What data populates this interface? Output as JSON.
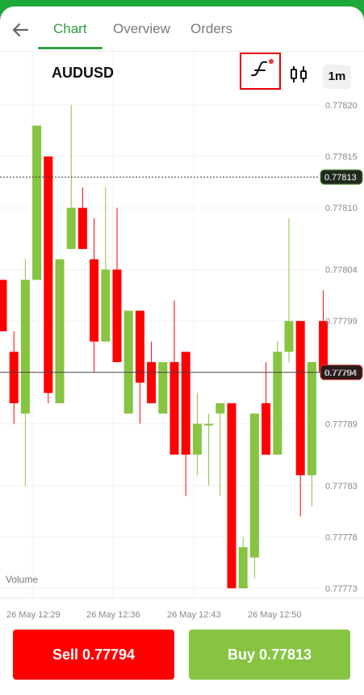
{
  "tabs": [
    {
      "label": "Chart",
      "active": true
    },
    {
      "label": "Overview",
      "active": false
    },
    {
      "label": "Orders",
      "active": false
    }
  ],
  "symbol": "AUDUSD",
  "timeframe": "1m",
  "toolbar": {
    "indicator_icon": "indicator-f-icon",
    "candle_icon": "candlestick-icon"
  },
  "chart_data": {
    "type": "candlestick",
    "y_ticks": [
      "0.77820",
      "0.77815",
      "0.77810",
      "0.77804",
      "0.77799",
      "0.77794",
      "0.77789",
      "0.77783",
      "0.77778",
      "0.77773"
    ],
    "ask_price": "0.77813",
    "bid_price": "0.77794",
    "x_ticks": [
      "26 May 12:29",
      "26 May 12:36",
      "26 May 12:43",
      "26 May 12:50"
    ],
    "volume_label": "Volume",
    "colors": {
      "up": "#86c442",
      "down": "#ff0000"
    },
    "candles": [
      {
        "o": 0.77803,
        "h": 0.77803,
        "l": 0.77798,
        "c": 0.77798
      },
      {
        "o": 0.77796,
        "h": 0.77798,
        "l": 0.77789,
        "c": 0.77791
      },
      {
        "o": 0.7779,
        "h": 0.77805,
        "l": 0.77783,
        "c": 0.77803
      },
      {
        "o": 0.77803,
        "h": 0.77818,
        "l": 0.77803,
        "c": 0.77818
      },
      {
        "o": 0.77815,
        "h": 0.77815,
        "l": 0.77791,
        "c": 0.77792
      },
      {
        "o": 0.77791,
        "h": 0.77805,
        "l": 0.77791,
        "c": 0.77805
      },
      {
        "o": 0.77806,
        "h": 0.7782,
        "l": 0.77806,
        "c": 0.7781
      },
      {
        "o": 0.7781,
        "h": 0.77812,
        "l": 0.77806,
        "c": 0.77806
      },
      {
        "o": 0.77805,
        "h": 0.77809,
        "l": 0.77794,
        "c": 0.77797
      },
      {
        "o": 0.77797,
        "h": 0.77812,
        "l": 0.77797,
        "c": 0.77804
      },
      {
        "o": 0.77804,
        "h": 0.7781,
        "l": 0.77795,
        "c": 0.77795
      },
      {
        "o": 0.7779,
        "h": 0.778,
        "l": 0.7779,
        "c": 0.778
      },
      {
        "o": 0.778,
        "h": 0.778,
        "l": 0.77789,
        "c": 0.77793
      },
      {
        "o": 0.77795,
        "h": 0.77797,
        "l": 0.77791,
        "c": 0.77791
      },
      {
        "o": 0.7779,
        "h": 0.77795,
        "l": 0.7779,
        "c": 0.77795
      },
      {
        "o": 0.77795,
        "h": 0.77801,
        "l": 0.77786,
        "c": 0.77786
      },
      {
        "o": 0.77796,
        "h": 0.77796,
        "l": 0.77782,
        "c": 0.77786
      },
      {
        "o": 0.77786,
        "h": 0.77792,
        "l": 0.77784,
        "c": 0.77789
      },
      {
        "o": 0.77789,
        "h": 0.7779,
        "l": 0.77783,
        "c": 0.77789
      },
      {
        "o": 0.7779,
        "h": 0.77791,
        "l": 0.77782,
        "c": 0.77791
      },
      {
        "o": 0.77791,
        "h": 0.77791,
        "l": 0.77773,
        "c": 0.77773
      },
      {
        "o": 0.77773,
        "h": 0.77778,
        "l": 0.77773,
        "c": 0.77777
      },
      {
        "o": 0.77776,
        "h": 0.7779,
        "l": 0.77774,
        "c": 0.7779
      },
      {
        "o": 0.77791,
        "h": 0.77795,
        "l": 0.77786,
        "c": 0.77786
      },
      {
        "o": 0.77786,
        "h": 0.77797,
        "l": 0.77786,
        "c": 0.77796
      },
      {
        "o": 0.77796,
        "h": 0.77809,
        "l": 0.77795,
        "c": 0.77799
      },
      {
        "o": 0.77799,
        "h": 0.77799,
        "l": 0.7778,
        "c": 0.77784
      },
      {
        "o": 0.77784,
        "h": 0.77795,
        "l": 0.77781,
        "c": 0.77795
      },
      {
        "o": 0.77799,
        "h": 0.77802,
        "l": 0.77794,
        "c": 0.77794
      }
    ]
  },
  "sell_button": "Sell 0.77794",
  "buy_button": "Buy 0.77813"
}
